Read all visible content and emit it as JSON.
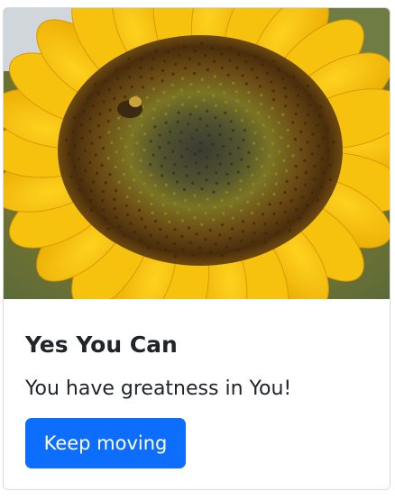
{
  "card": {
    "image_alt": "sunflower",
    "title": "Yes You Can",
    "text": "You have greatness in You!",
    "button_label": "Keep moving"
  },
  "colors": {
    "button": "#0d6efd",
    "text": "#212529",
    "border": "#d7dadd"
  }
}
